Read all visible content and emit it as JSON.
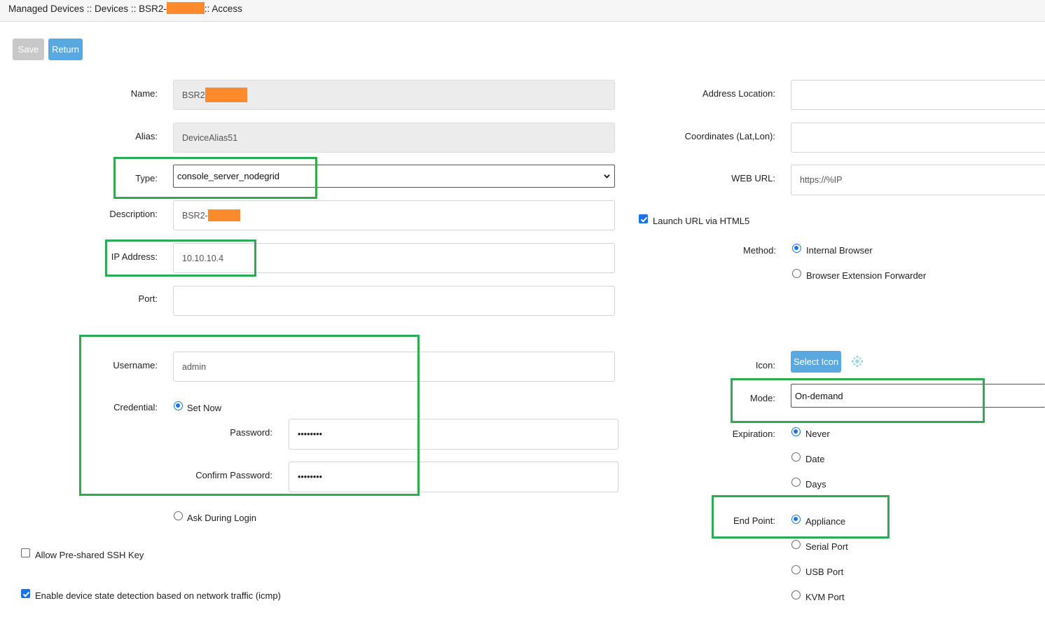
{
  "header": {
    "breadcrumb_part1": "Managed Devices :: Devices :: BSR2-",
    "breadcrumb_part2": ":: Access"
  },
  "toolbar": {
    "save_label": "Save",
    "return_label": "Return"
  },
  "left_form": {
    "name_label": "Name:",
    "name_value": "BSR2",
    "alias_label": "Alias:",
    "alias_value": "DeviceAlias51",
    "type_label": "Type:",
    "type_value": "console_server_nodegrid",
    "description_label": "Description:",
    "description_value": "BSR2-",
    "ip_label": "IP Address:",
    "ip_value": "10.10.10.4",
    "port_label": "Port:",
    "port_value": "",
    "username_label": "Username:",
    "username_value": "admin",
    "credential_label": "Credential:",
    "credential_set_now": "Set Now",
    "password_label": "Password:",
    "password_value": "••••••••",
    "confirm_password_label": "Confirm Password:",
    "confirm_password_value": "••••••••",
    "ask_during_login": "Ask During Login",
    "allow_ssh_key": "Allow Pre-shared SSH Key",
    "enable_state_detection": "Enable device state detection based on network traffic (icmp)"
  },
  "right_form": {
    "address_location_label": "Address Location:",
    "address_location_value": "",
    "coordinates_label": "Coordinates (Lat,Lon):",
    "coordinates_value": "",
    "web_url_label": "WEB URL:",
    "web_url_value": "https://%IP",
    "launch_url_html5": "Launch URL via HTML5",
    "method_label": "Method:",
    "method_internal": "Internal Browser",
    "method_extension": "Browser Extension Forwarder",
    "icon_label": "Icon:",
    "select_icon_label": "Select Icon",
    "mode_label": "Mode:",
    "mode_value": "On-demand",
    "expiration_label": "Expiration:",
    "expiration_never": "Never",
    "expiration_date": "Date",
    "expiration_days": "Days",
    "endpoint_label": "End Point:",
    "endpoint_appliance": "Appliance",
    "endpoint_serial": "Serial Port",
    "endpoint_usb": "USB Port",
    "endpoint_kvm": "KVM Port"
  },
  "colors": {
    "highlight": "#2eab4f",
    "accent": "#5aa8e0",
    "redaction": "#ff8a2b",
    "radio_on": "#1a73e8"
  }
}
